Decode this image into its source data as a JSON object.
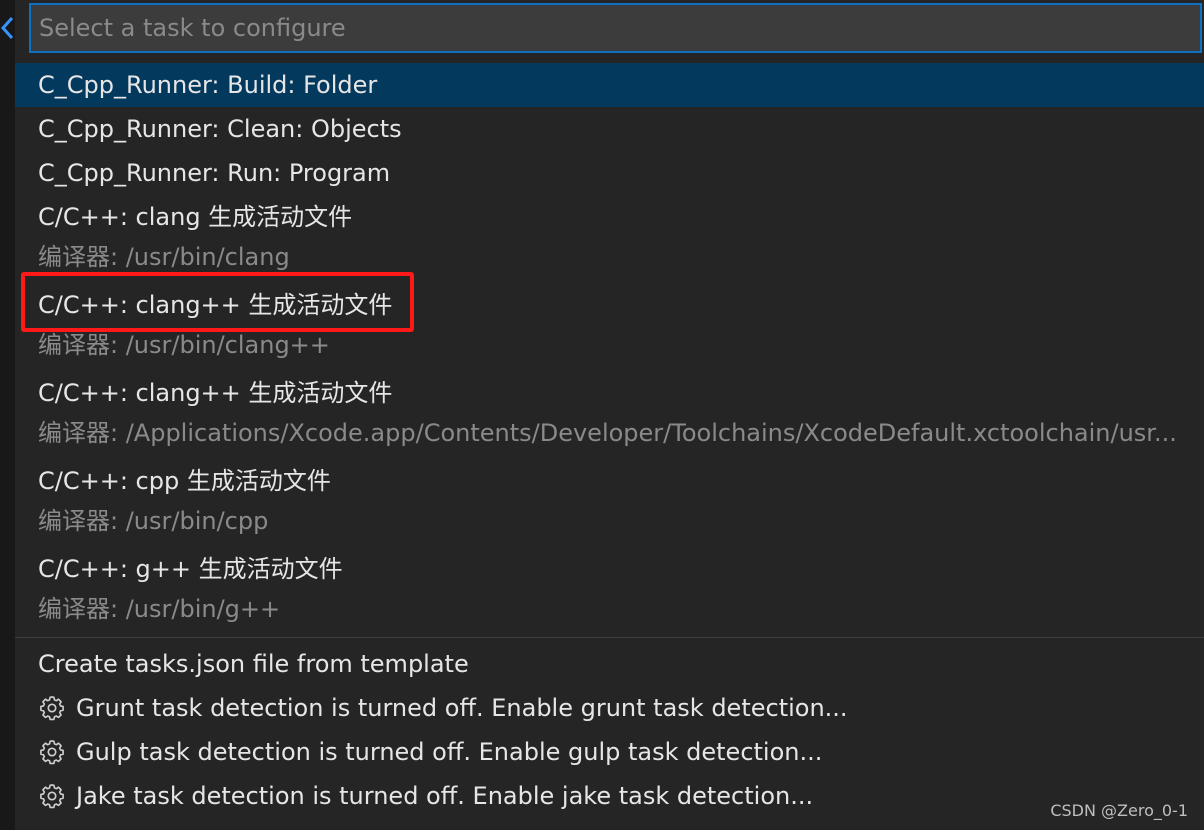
{
  "search": {
    "placeholder": "Select a task to configure",
    "value": ""
  },
  "tasks": [
    {
      "label": "C_Cpp_Runner: Build: Folder",
      "description": "",
      "selected": true
    },
    {
      "label": "C_Cpp_Runner: Clean: Objects",
      "description": ""
    },
    {
      "label": "C_Cpp_Runner: Run: Program",
      "description": ""
    },
    {
      "label": "C/C++: clang 生成活动文件",
      "description": "编译器: /usr/bin/clang"
    },
    {
      "label": "C/C++: clang++ 生成活动文件",
      "description": "编译器: /usr/bin/clang++",
      "highlighted": true
    },
    {
      "label": "C/C++: clang++ 生成活动文件",
      "description": "编译器: /Applications/Xcode.app/Contents/Developer/Toolchains/XcodeDefault.xctoolchain/usr..."
    },
    {
      "label": "C/C++: cpp 生成活动文件",
      "description": "编译器: /usr/bin/cpp"
    },
    {
      "label": "C/C++: g++ 生成活动文件",
      "description": "编译器: /usr/bin/g++"
    }
  ],
  "template_item": "Create tasks.json file from template",
  "detection_items": [
    {
      "label": "Grunt task detection is turned off. Enable grunt task detection...",
      "icon": "gear-icon"
    },
    {
      "label": "Gulp task detection is turned off. Enable gulp task detection...",
      "icon": "gear-icon"
    },
    {
      "label": "Jake task detection is turned off. Enable jake task detection...",
      "icon": "gear-icon"
    }
  ],
  "watermark": "CSDN @Zero_0-1",
  "colors": {
    "selected_row": "#04395e",
    "focus_border": "#0e70c0",
    "highlight_box": "#ff1a1a",
    "back_chevron": "#3794ff"
  }
}
